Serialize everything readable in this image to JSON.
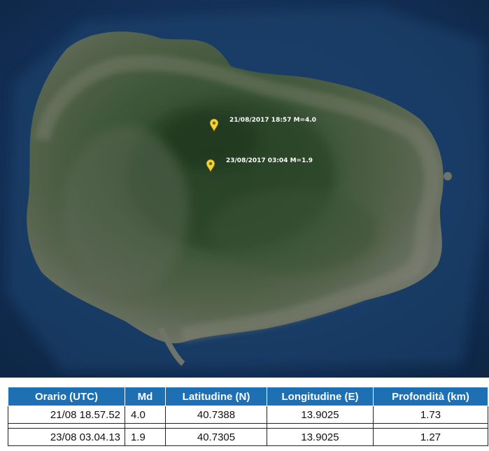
{
  "map": {
    "markers": [
      {
        "label": "21/08/2017 18:57 M=4.0",
        "icon": "map-pin-icon",
        "color": "#f2d23a"
      },
      {
        "label": "23/08/2017 03:04 M=1.9",
        "icon": "map-pin-icon",
        "color": "#f2d23a"
      }
    ]
  },
  "table": {
    "headers": [
      "Orario (UTC)",
      "Md",
      "Latitudine (N)",
      "Longitudine (E)",
      "Profondità (km)"
    ],
    "rows": [
      [
        "21/08  18.57.52",
        "4.0",
        "40.7388",
        "13.9025",
        "1.73"
      ],
      [
        "23/08  03.04.13",
        "1.9",
        "40.7305",
        "13.9025",
        "1.27"
      ]
    ],
    "header_color": "#1f6fb3"
  }
}
